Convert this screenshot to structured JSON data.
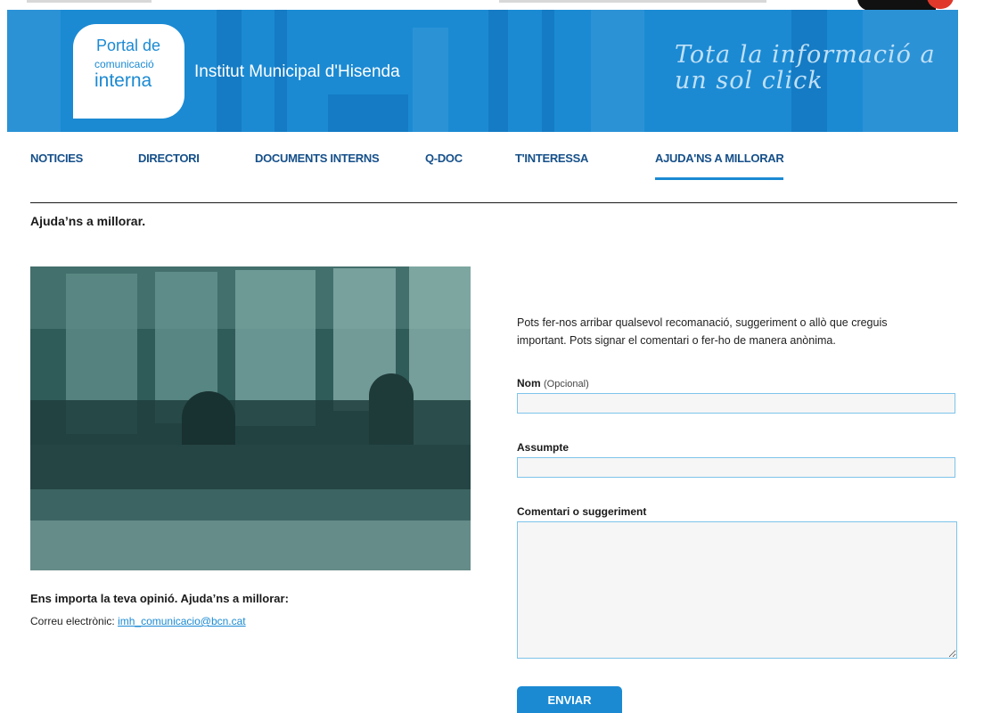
{
  "header": {
    "logo": {
      "line1": "Portal de",
      "line2": "comunicació",
      "line3": "interna"
    },
    "org_name": "Institut Municipal d'Hisenda",
    "tagline": "Tota la informació a un sol click"
  },
  "nav": {
    "items": [
      {
        "label": "NOTICIES"
      },
      {
        "label": "DIRECTORI"
      },
      {
        "label": "DOCUMENTS INTERNS"
      },
      {
        "label": "Q-DOC"
      },
      {
        "label": "T'INTERESSA"
      },
      {
        "label": "AJUDA'NS A MILLORAR",
        "active": true
      }
    ]
  },
  "page": {
    "title": "Ajuda’ns a millorar."
  },
  "contact": {
    "title": "Ens importa la teva opinió. Ajuda’ns a millorar:",
    "email_label": "Correu electrònic:",
    "email": "imh_comunicacio@bcn.cat"
  },
  "form": {
    "intro": "Pots fer-nos arribar qualsevol recomanació, suggeriment o allò que creguis important. Pots signar el comentari o fer-ho de manera anònima.",
    "name_label": "Nom",
    "name_optional": "(Opcional)",
    "name_value": "",
    "subject_label": "Assumpte",
    "subject_value": "",
    "comment_label": "Comentari o suggeriment",
    "comment_value": "",
    "submit_label": "ENVIAR"
  },
  "colors": {
    "brand_blue": "#1b8ad3",
    "nav_text": "#16508a",
    "input_border": "#7ec4ea"
  }
}
